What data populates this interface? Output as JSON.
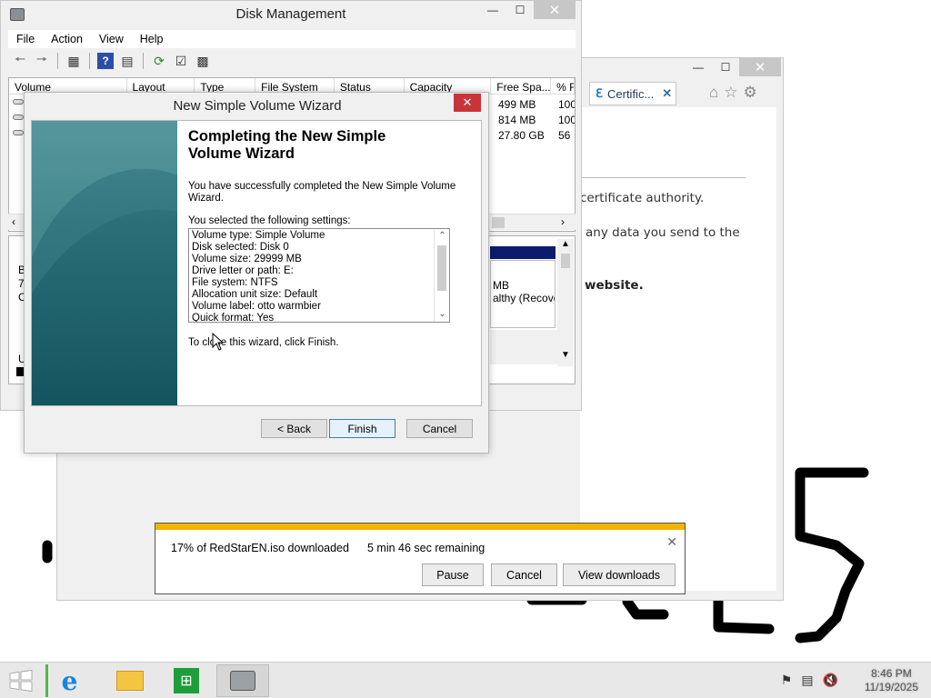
{
  "colors": {
    "accent_download": "#f1b500",
    "close_red": "#c7343a",
    "disk_bar": "#0b1b6e",
    "wizard_teal": "#14545f"
  },
  "disk_management": {
    "title": "Disk Management",
    "menu": [
      "File",
      "Action",
      "View",
      "Help"
    ],
    "columns": [
      "Volume",
      "Layout",
      "Type",
      "File System",
      "Status",
      "Capacity",
      "Free Spa...",
      "% F"
    ],
    "rows": [
      {
        "free": "499 MB",
        "pct": "100"
      },
      {
        "free": "814 MB",
        "pct": "100"
      },
      {
        "free": "27.80 GB",
        "pct": "56"
      }
    ],
    "left_letters": [
      "B",
      "7",
      "C",
      "U"
    ],
    "disk_box_lines": [
      "MB",
      "althy (Recove"
    ],
    "icons": [
      "back-arrow-icon",
      "forward-arrow-icon",
      "console-icon",
      "help-icon",
      "list-icon",
      "refresh-icon",
      "properties-icon",
      "settings-icon"
    ]
  },
  "ie": {
    "tab_label": "Certific...",
    "lines": [
      "certificate authority.",
      "any data you send to the",
      "website."
    ]
  },
  "wizard": {
    "title": "New Simple Volume Wizard",
    "heading_line1": "Completing the New Simple",
    "heading_line2": "Volume Wizard",
    "success_text": "You have successfully completed the New Simple Volume Wizard.",
    "settings_label": "You selected the following settings:",
    "settings": [
      "Volume type: Simple Volume",
      "Disk selected: Disk 0",
      "Volume size: 29999 MB",
      "Drive letter or path: E:",
      "File system: NTFS",
      "Allocation unit size: Default",
      "Volume label: otto warmbier",
      "Quick format: Yes"
    ],
    "finish_text": "To close this wizard, click Finish.",
    "back_label": "< Back",
    "finish_label": "Finish",
    "cancel_label": "Cancel"
  },
  "download": {
    "progress_percent": 17,
    "status": "17% of RedStarEN.iso downloaded",
    "remaining": "5 min 46 sec remaining",
    "pause_label": "Pause",
    "cancel_label": "Cancel",
    "view_label": "View downloads"
  },
  "taskbar": {
    "apps": [
      "internet-explorer-icon",
      "file-explorer-icon",
      "store-icon",
      "disk-management-icon"
    ],
    "tray": [
      "flag-icon",
      "network-icon",
      "speaker-muted-icon"
    ],
    "time": "8:46 PM",
    "date": "11/19/2025"
  }
}
